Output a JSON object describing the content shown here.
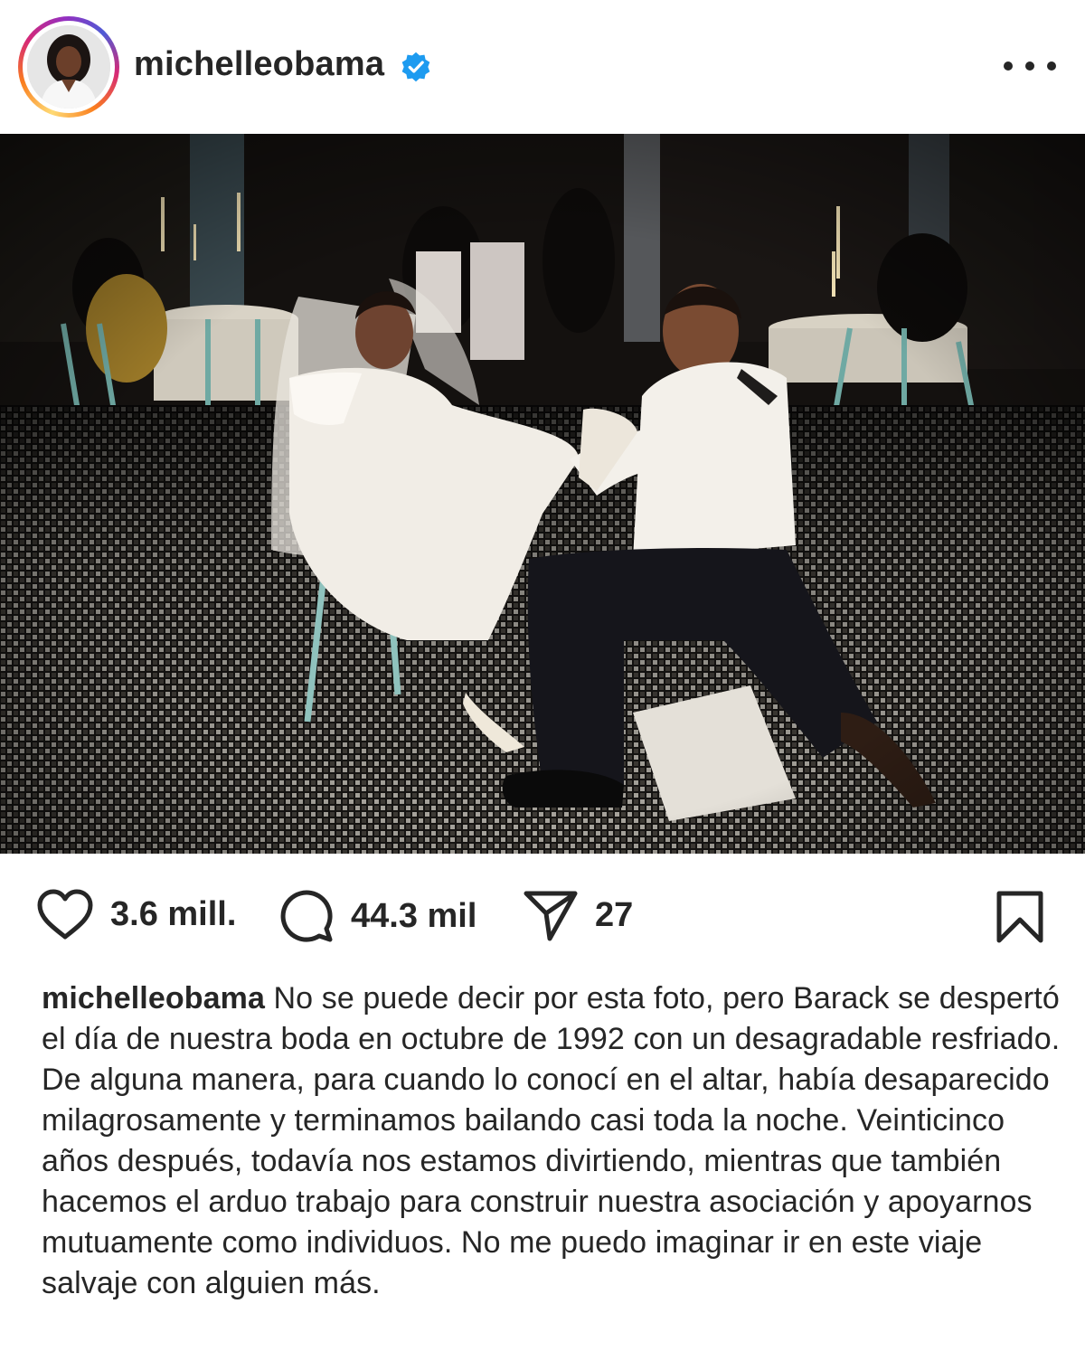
{
  "post": {
    "username": "michelleobama",
    "verified": true,
    "more_icon": "more-horizontal-icon"
  },
  "photo": {
    "alt_icon": "wedding-photo"
  },
  "actions": {
    "likes": "3.6 mill.",
    "comments": "44.3 mil",
    "shares": "27",
    "icons": [
      "heart-icon",
      "comment-icon",
      "send-icon",
      "bookmark-icon"
    ]
  },
  "caption": {
    "username": "michelleobama",
    "text": "No se puede decir por esta foto, pero Barack se despertó el día de nuestra boda en octubre de 1992 con un desagradable resfriado. De alguna manera, para cuando lo conocí en el altar, había desaparecido milagrosamente y terminamos bailando casi toda la noche. Veinticinco años después, todavía nos estamos divirtiendo, mientras que también hacemos el arduo trabajo para construir nuestra asociación y apoyarnos mutuamente como individuos. No me puedo imaginar ir en este viaje salvaje con alguien más."
  },
  "colors": {
    "text": "#262626",
    "verified_blue": "#1d9bf0",
    "background": "#ffffff"
  }
}
